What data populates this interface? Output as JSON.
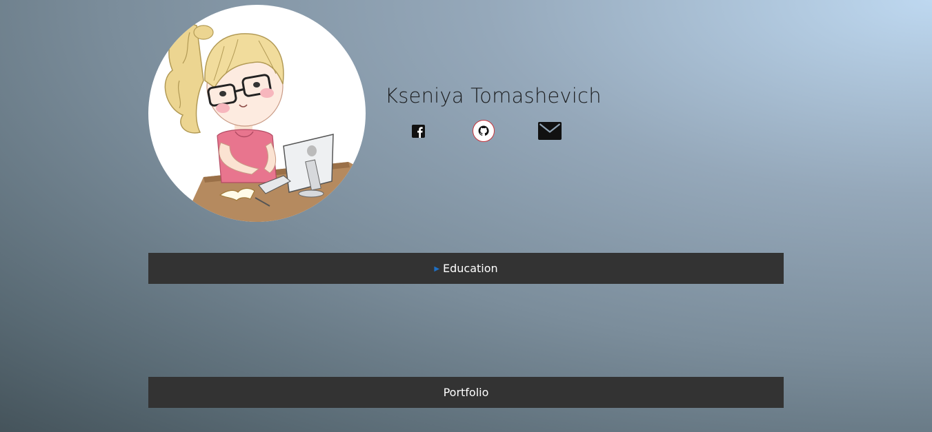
{
  "profile": {
    "name": "Kseniya Tomashevich",
    "avatar_icon": "girl-at-computer-illustration"
  },
  "social": [
    {
      "name": "facebook",
      "icon": "facebook-icon"
    },
    {
      "name": "github",
      "icon": "github-icon"
    },
    {
      "name": "email",
      "icon": "mail-icon"
    }
  ],
  "sections": {
    "education": {
      "label": "Education",
      "marker": "▶"
    },
    "portfolio": {
      "label": "Portfolio"
    }
  },
  "colors": {
    "bar_background": "#333333",
    "bar_text": "#ffffff",
    "marker": "#1e6fc4",
    "github_ring": "#c8323a",
    "name_text": "#1d1f21"
  }
}
